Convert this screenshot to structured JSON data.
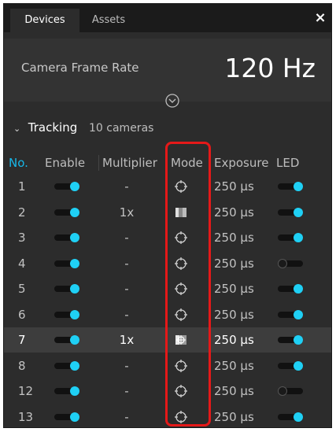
{
  "tabs": [
    {
      "label": "Devices",
      "active": true
    },
    {
      "label": "Assets",
      "active": false
    }
  ],
  "close_label": "×",
  "frame_rate": {
    "label": "Camera Frame Rate",
    "value": "120 Hz"
  },
  "tracking": {
    "label": "Tracking",
    "count": "10 cameras"
  },
  "columns": {
    "no": "No.",
    "enable": "Enable",
    "multiplier": "Multiplier",
    "mode": "Mode",
    "exposure": "Exposure",
    "led": "LED"
  },
  "rows": [
    {
      "no": "1",
      "enable": true,
      "multiplier": "-",
      "mode": "crosshair-icon",
      "exposure": "250 µs",
      "led": true
    },
    {
      "no": "2",
      "enable": true,
      "multiplier": "1x",
      "mode": "grayscale-icon",
      "exposure": "250 µs",
      "led": true
    },
    {
      "no": "3",
      "enable": true,
      "multiplier": "-",
      "mode": "crosshair-icon",
      "exposure": "250 µs",
      "led": true
    },
    {
      "no": "4",
      "enable": true,
      "multiplier": "-",
      "mode": "crosshair-icon",
      "exposure": "250 µs",
      "led": false
    },
    {
      "no": "5",
      "enable": true,
      "multiplier": "-",
      "mode": "crosshair-icon",
      "exposure": "250 µs",
      "led": true
    },
    {
      "no": "6",
      "enable": true,
      "multiplier": "-",
      "mode": "crosshair-icon",
      "exposure": "250 µs",
      "led": true
    },
    {
      "no": "7",
      "enable": true,
      "multiplier": "1x",
      "mode": "object-mode-icon",
      "exposure": "250 µs",
      "led": true,
      "selected": true
    },
    {
      "no": "8",
      "enable": true,
      "multiplier": "-",
      "mode": "crosshair-icon",
      "exposure": "250 µs",
      "led": true
    },
    {
      "no": "12",
      "enable": true,
      "multiplier": "-",
      "mode": "crosshair-icon",
      "exposure": "250 µs",
      "led": false
    },
    {
      "no": "13",
      "enable": true,
      "multiplier": "-",
      "mode": "crosshair-icon",
      "exposure": "250 µs",
      "led": true
    }
  ],
  "colors": {
    "accent": "#1fd0f5",
    "header_accent": "#17b7e8",
    "highlight": "#e51919",
    "panel_bg": "#2c2c2c"
  }
}
